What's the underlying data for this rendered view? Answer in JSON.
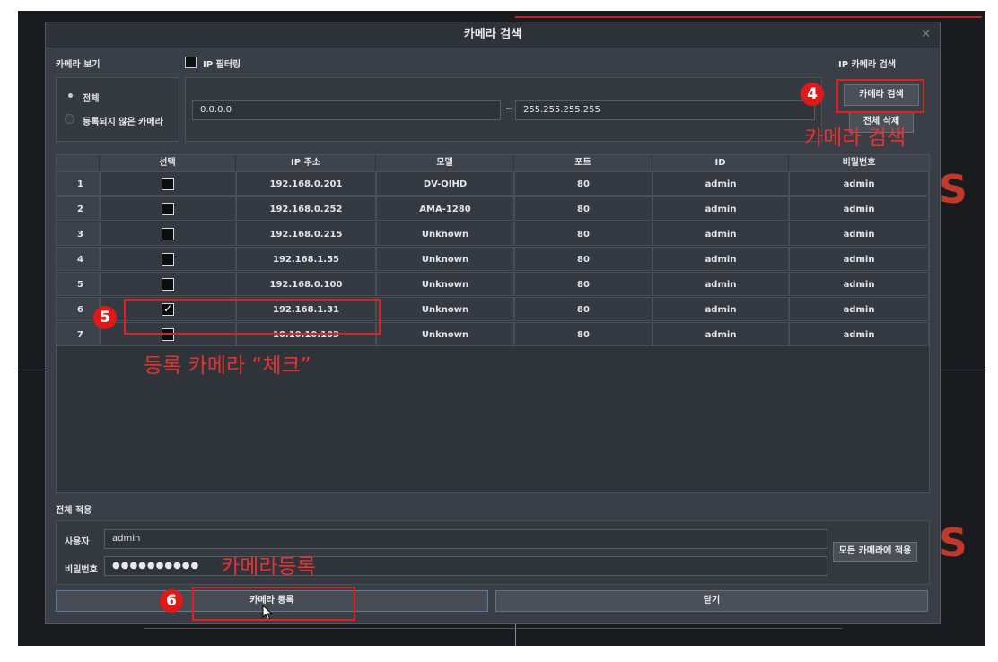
{
  "dialog": {
    "title": "카메라 검색"
  },
  "view": {
    "label": "카메라 보기",
    "option_all": "전체",
    "option_unregistered": "등록되지 않은 카메라"
  },
  "ip_filter": {
    "label": "IP 필터링",
    "start": "0.0.0.0",
    "separator": "~",
    "end": "255.255.255.255"
  },
  "ip_search": {
    "label": "IP 카메라 검색",
    "search_button": "카메라 검색",
    "delete_all_button": "전체 삭제"
  },
  "table": {
    "columns": [
      "선택",
      "IP 주소",
      "모델",
      "포트",
      "ID",
      "비밀번호"
    ],
    "rows": [
      {
        "num": "1",
        "ip": "192.168.0.201",
        "model": "DV-QIHD",
        "port": "80",
        "id": "admin",
        "pw": "admin"
      },
      {
        "num": "2",
        "ip": "192.168.0.252",
        "model": "AMA-1280",
        "port": "80",
        "id": "admin",
        "pw": "admin"
      },
      {
        "num": "3",
        "ip": "192.168.0.215",
        "model": "Unknown",
        "port": "80",
        "id": "admin",
        "pw": "admin"
      },
      {
        "num": "4",
        "ip": "192.168.1.55",
        "model": "Unknown",
        "port": "80",
        "id": "admin",
        "pw": "admin"
      },
      {
        "num": "5",
        "ip": "192.168.0.100",
        "model": "Unknown",
        "port": "80",
        "id": "admin",
        "pw": "admin"
      },
      {
        "num": "6",
        "ip": "192.168.1.31",
        "model": "Unknown",
        "port": "80",
        "id": "admin",
        "pw": "admin"
      },
      {
        "num": "7",
        "ip": "10.10.10.103",
        "model": "Unknown",
        "port": "80",
        "id": "admin",
        "pw": "admin"
      }
    ],
    "checkmark": "✓"
  },
  "apply_all": {
    "label": "전체 적용",
    "user_label": "사용자",
    "user_value": "admin",
    "password_label": "비밀번호",
    "password_value": "●●●●●●●●●●",
    "apply_button": "모든 카메라에 적용"
  },
  "footer": {
    "register_button": "카메라 등록",
    "close_button": "닫기"
  },
  "annotations": {
    "step4": "4",
    "step4_text": "카메라 검색",
    "step5": "5",
    "step5_text": "등록 카메라 “체크”",
    "step6": "6",
    "step6_text": "카메라등록"
  },
  "background": {
    "side_letter": "S"
  },
  "colors": {
    "annotation_red": "#e02020",
    "dialog_bg": "#3a3f47"
  }
}
